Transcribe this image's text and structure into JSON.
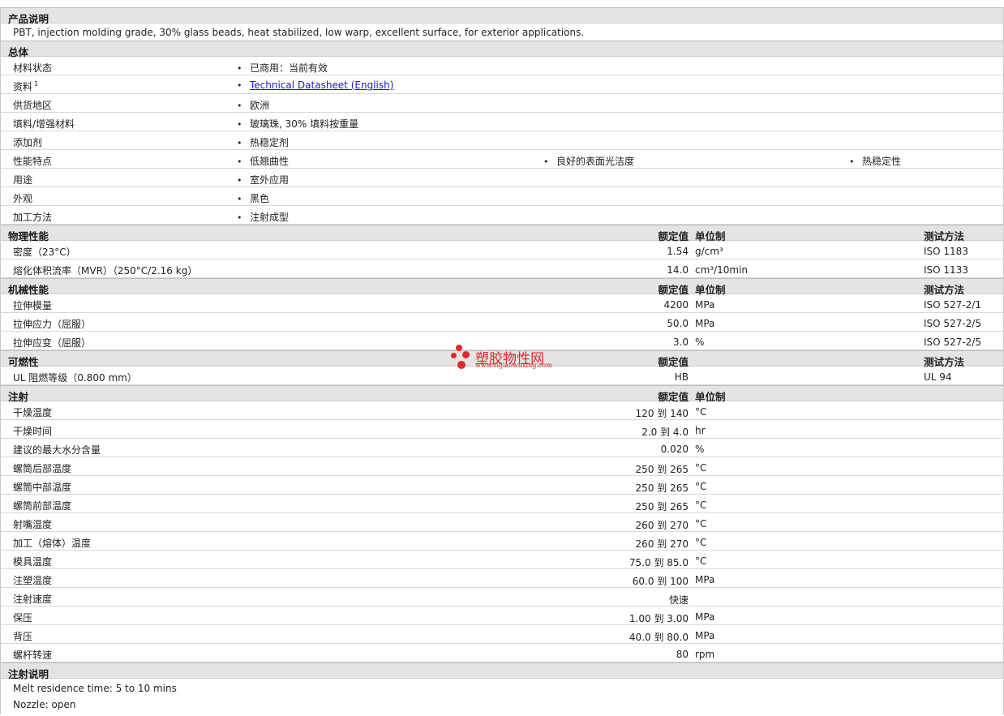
{
  "desc": {
    "title": "产品说明",
    "text": "PBT, injection molding grade, 30% glass beads, heat stabilized, low warp, excellent surface, for exterior applications."
  },
  "general": {
    "title": "总体",
    "rows": [
      {
        "label": "材料状态",
        "v1": "已商用：当前有效"
      },
      {
        "label": "资料",
        "sup": "1",
        "link": "Technical Datasheet (English)"
      },
      {
        "label": "供货地区",
        "v1": "欧洲"
      },
      {
        "label": "填料/增强材料",
        "v1": "玻璃珠, 30% 填料按重量"
      },
      {
        "label": "添加剂",
        "v1": "热稳定剂"
      },
      {
        "label": "性能特点",
        "v1": "低翘曲性",
        "v2": "良好的表面光洁度",
        "v3": "热稳定性"
      },
      {
        "label": "用途",
        "v1": "室外应用"
      },
      {
        "label": "外观",
        "v1": "黑色"
      },
      {
        "label": "加工方法",
        "v1": "注射成型"
      }
    ]
  },
  "physical": {
    "title": "物理性能",
    "col_value": "额定值",
    "col_unit": "单位制",
    "col_method": "测试方法",
    "rows": [
      {
        "label": "密度（23°C）",
        "value": "1.54",
        "unit": "g/cm³",
        "method": "ISO 1183"
      },
      {
        "label": "熔化体积流率（MVR）（250°C/2.16 kg）",
        "value": "14.0",
        "unit": "cm³/10min",
        "method": "ISO 1133"
      }
    ]
  },
  "mechanical": {
    "title": "机械性能",
    "col_value": "额定值",
    "col_unit": "单位制",
    "col_method": "测试方法",
    "rows": [
      {
        "label": "拉伸模量",
        "value": "4200",
        "unit": "MPa",
        "method": "ISO 527-2/1"
      },
      {
        "label": "拉伸应力（屈服）",
        "value": "50.0",
        "unit": "MPa",
        "method": "ISO 527-2/5"
      },
      {
        "label": "拉伸应变（屈服）",
        "value": "3.0",
        "unit": "%",
        "method": "ISO 527-2/5"
      }
    ]
  },
  "flammability": {
    "title": "可燃性",
    "col_value": "额定值",
    "col_method": "测试方法",
    "rows": [
      {
        "label": "UL 阻燃等级（0.800 mm）",
        "value": "HB",
        "unit": "",
        "method": "UL 94"
      }
    ]
  },
  "injection": {
    "title": "注射",
    "col_value": "额定值",
    "col_unit": "单位制",
    "rows": [
      {
        "label": "干燥温度",
        "value": "120 到  140",
        "unit": "°C"
      },
      {
        "label": "干燥时间",
        "value": "2.0 到  4.0",
        "unit": "hr"
      },
      {
        "label": "建议的最大水分含量",
        "value": "0.020",
        "unit": "%"
      },
      {
        "label": "螺筒后部温度",
        "value": "250 到  265",
        "unit": "°C"
      },
      {
        "label": "螺筒中部温度",
        "value": "250 到  265",
        "unit": "°C"
      },
      {
        "label": "螺筒前部温度",
        "value": "250 到  265",
        "unit": "°C"
      },
      {
        "label": "射嘴温度",
        "value": "260 到  270",
        "unit": "°C"
      },
      {
        "label": "加工（熔体）温度",
        "value": "260 到  270",
        "unit": "°C"
      },
      {
        "label": "模具温度",
        "value": "75.0 到  85.0",
        "unit": "°C"
      },
      {
        "label": "注塑温度",
        "value": "60.0 到  100",
        "unit": "MPa"
      },
      {
        "label": "注射速度",
        "value": "快速",
        "unit": ""
      },
      {
        "label": "保压",
        "value": "1.00 到  3.00",
        "unit": "MPa"
      },
      {
        "label": "背压",
        "value": "40.0 到  80.0",
        "unit": "MPa"
      },
      {
        "label": "螺杆转速",
        "value": "80",
        "unit": "rpm"
      }
    ]
  },
  "notes": {
    "title": "注射说明",
    "lines": [
      "Melt residence time: 5 to 10 mins",
      "Nozzle: open"
    ]
  },
  "watermark": {
    "name": "塑胶物性网",
    "url": "www.sujiaowuxing.com"
  }
}
